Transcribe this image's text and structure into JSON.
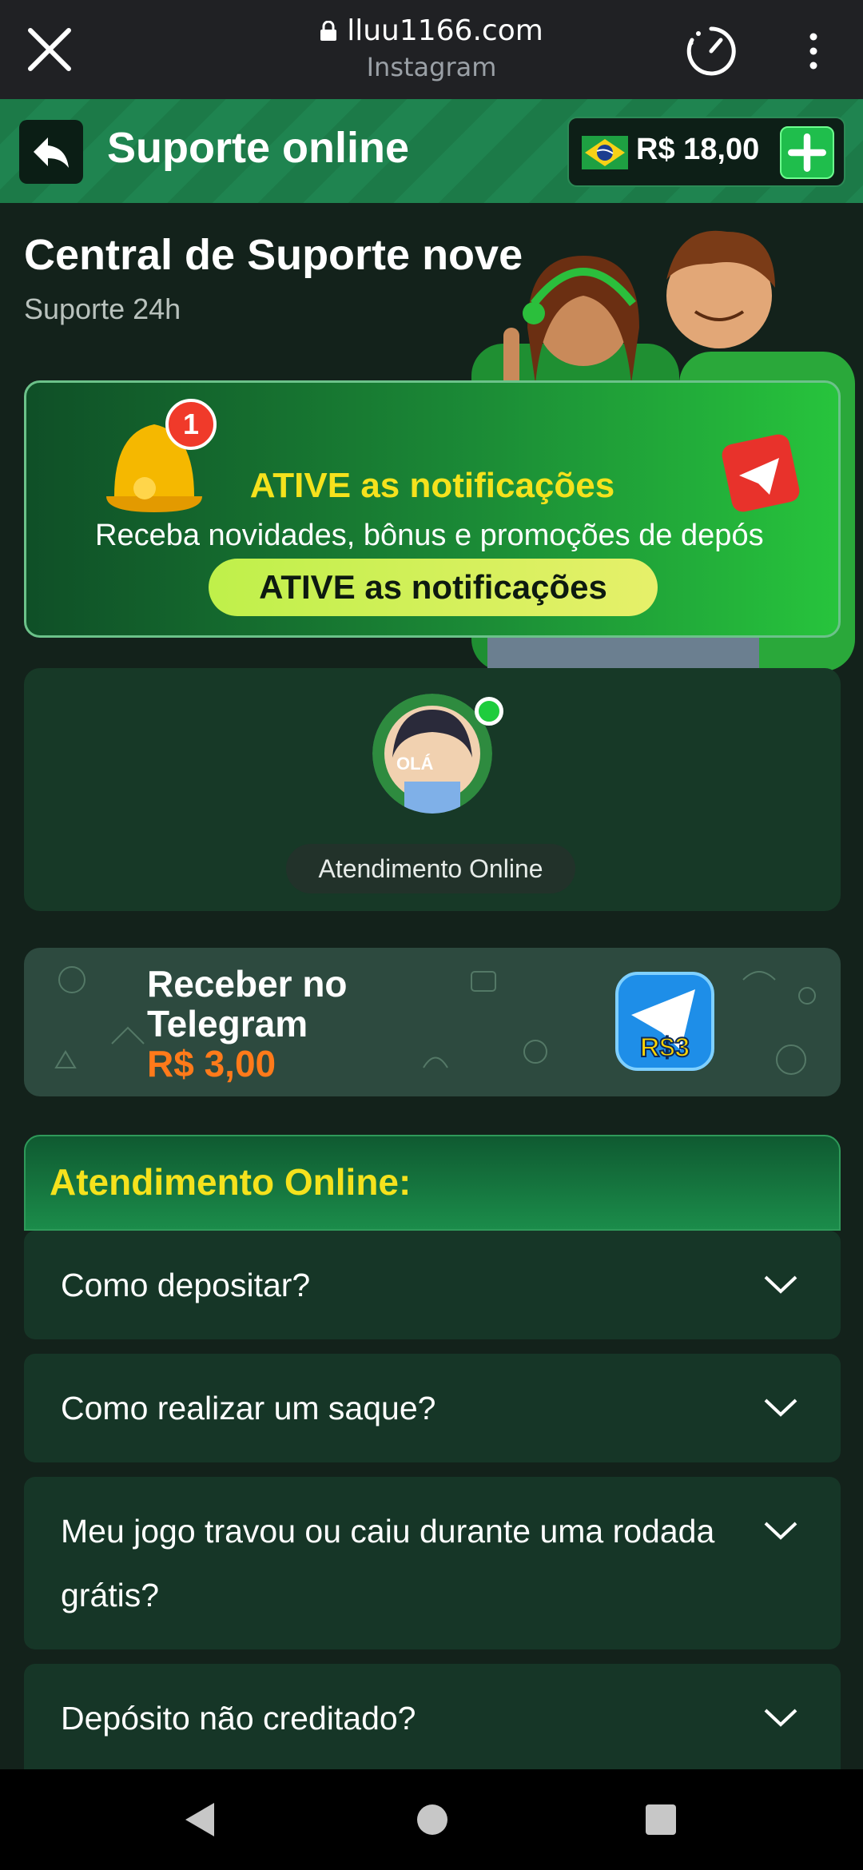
{
  "browser": {
    "domain": "lluu1166.com",
    "subtitle": "Instagram"
  },
  "header": {
    "title": "Suporte online",
    "balance": "R$ 18,00"
  },
  "page": {
    "title": "Central de Suporte nove",
    "subtitle": "Suporte 24h"
  },
  "notification_banner": {
    "badge": "1",
    "heading": "ATIVE as notificações",
    "description": "Receba novidades, bônus e promoções de depós",
    "button_label": "ATIVE as notificações"
  },
  "support": {
    "avatar_text": "OLÁ",
    "label": "Atendimento Online"
  },
  "telegram": {
    "title": "Receber no Telegram",
    "reward": "R$ 3,00",
    "icon_text": "R$3"
  },
  "faq": {
    "header": "Atendimento Online:",
    "items": [
      {
        "question": "Como depositar?"
      },
      {
        "question": "Como realizar um saque?"
      },
      {
        "question": "Meu jogo travou ou caiu durante uma rodada grátis?"
      },
      {
        "question": "Depósito não creditado?"
      }
    ]
  },
  "colors": {
    "accent_yellow": "#f5e21d",
    "accent_green": "#1fbe4c",
    "reward_orange": "#ff7a1a",
    "background": "#13221b"
  }
}
